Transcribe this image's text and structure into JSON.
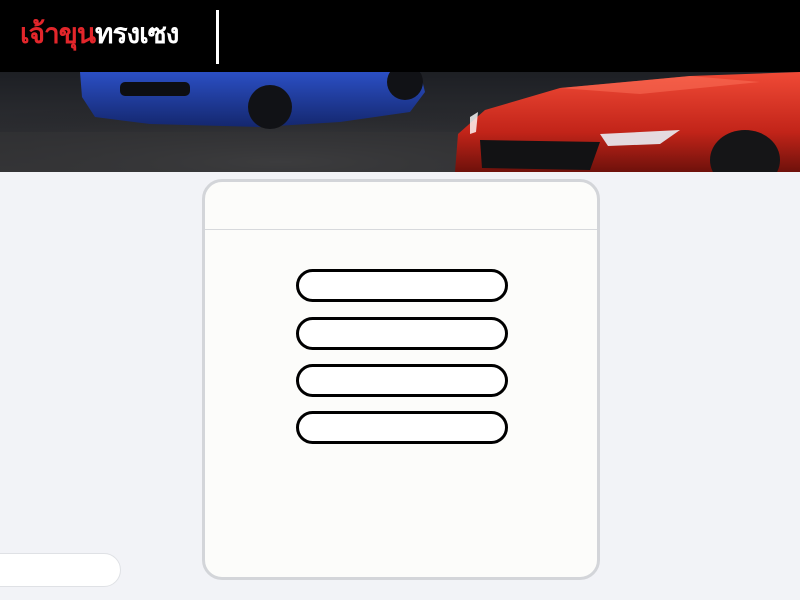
{
  "header": {
    "logo_part1": "เจ้าขุน",
    "logo_part2": "ทรงเซง",
    "brand_red": "#e3262b",
    "background": "#000000"
  },
  "hero": {
    "image": "banner-cars-photo",
    "car_colors": [
      "#1f3c9e",
      "#c9281f"
    ]
  },
  "modal": {
    "title": "",
    "buttons": [
      {
        "label": ""
      },
      {
        "label": ""
      },
      {
        "label": ""
      },
      {
        "label": ""
      }
    ]
  },
  "side_pill": {
    "label": ""
  }
}
